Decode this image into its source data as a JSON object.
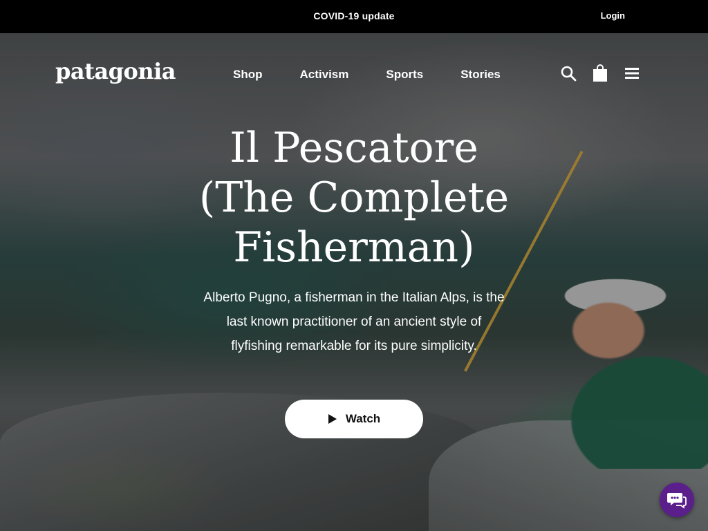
{
  "topbar": {
    "notice": "COVID-19 update",
    "login": "Login"
  },
  "nav": {
    "logo": "patagonia",
    "items": [
      "Shop",
      "Activism",
      "Sports",
      "Stories"
    ],
    "icons": [
      "search-icon",
      "shopping-bag-icon",
      "menu-icon"
    ]
  },
  "hero": {
    "title_lines": [
      "Il Pescatore",
      "(The Complete",
      "Fisherman)"
    ],
    "description": "Alberto Pugno, a fisherman in the Italian Alps, is the last known practitioner of an ancient style of flyfishing remarkable for its pure simplicity.",
    "watch_label": "Watch"
  },
  "chat": {
    "icon": "chat-icon",
    "color": "#5b1f8c"
  }
}
